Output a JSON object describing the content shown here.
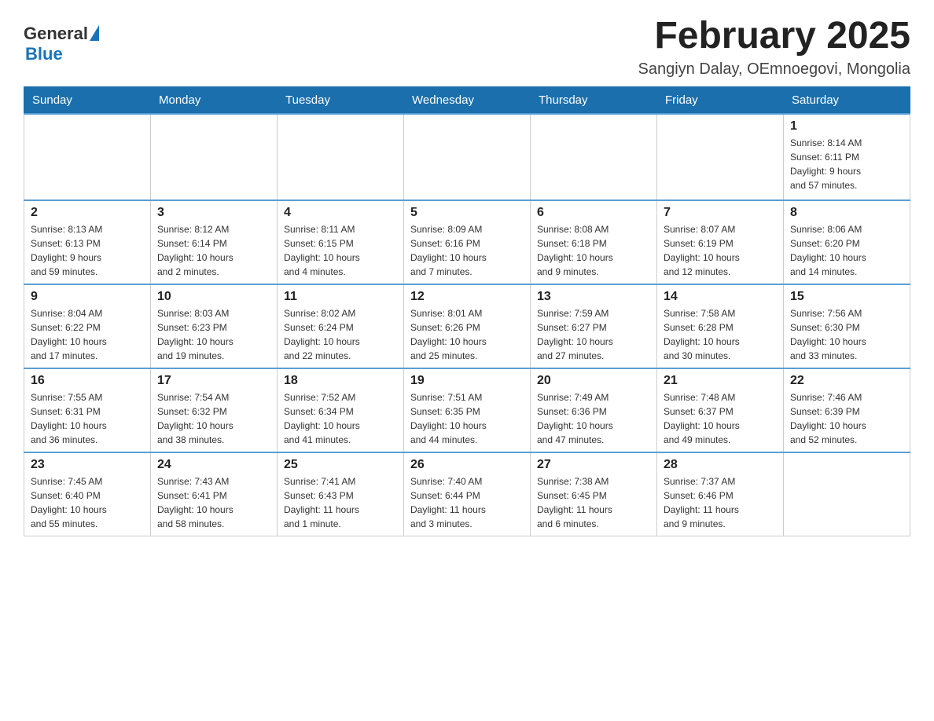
{
  "header": {
    "logo": {
      "general": "General",
      "blue": "Blue"
    },
    "title": "February 2025",
    "subtitle": "Sangiyn Dalay, OEmnoegovi, Mongolia"
  },
  "weekdays": [
    "Sunday",
    "Monday",
    "Tuesday",
    "Wednesday",
    "Thursday",
    "Friday",
    "Saturday"
  ],
  "weeks": [
    [
      {
        "day": "",
        "info": ""
      },
      {
        "day": "",
        "info": ""
      },
      {
        "day": "",
        "info": ""
      },
      {
        "day": "",
        "info": ""
      },
      {
        "day": "",
        "info": ""
      },
      {
        "day": "",
        "info": ""
      },
      {
        "day": "1",
        "info": "Sunrise: 8:14 AM\nSunset: 6:11 PM\nDaylight: 9 hours\nand 57 minutes."
      }
    ],
    [
      {
        "day": "2",
        "info": "Sunrise: 8:13 AM\nSunset: 6:13 PM\nDaylight: 9 hours\nand 59 minutes."
      },
      {
        "day": "3",
        "info": "Sunrise: 8:12 AM\nSunset: 6:14 PM\nDaylight: 10 hours\nand 2 minutes."
      },
      {
        "day": "4",
        "info": "Sunrise: 8:11 AM\nSunset: 6:15 PM\nDaylight: 10 hours\nand 4 minutes."
      },
      {
        "day": "5",
        "info": "Sunrise: 8:09 AM\nSunset: 6:16 PM\nDaylight: 10 hours\nand 7 minutes."
      },
      {
        "day": "6",
        "info": "Sunrise: 8:08 AM\nSunset: 6:18 PM\nDaylight: 10 hours\nand 9 minutes."
      },
      {
        "day": "7",
        "info": "Sunrise: 8:07 AM\nSunset: 6:19 PM\nDaylight: 10 hours\nand 12 minutes."
      },
      {
        "day": "8",
        "info": "Sunrise: 8:06 AM\nSunset: 6:20 PM\nDaylight: 10 hours\nand 14 minutes."
      }
    ],
    [
      {
        "day": "9",
        "info": "Sunrise: 8:04 AM\nSunset: 6:22 PM\nDaylight: 10 hours\nand 17 minutes."
      },
      {
        "day": "10",
        "info": "Sunrise: 8:03 AM\nSunset: 6:23 PM\nDaylight: 10 hours\nand 19 minutes."
      },
      {
        "day": "11",
        "info": "Sunrise: 8:02 AM\nSunset: 6:24 PM\nDaylight: 10 hours\nand 22 minutes."
      },
      {
        "day": "12",
        "info": "Sunrise: 8:01 AM\nSunset: 6:26 PM\nDaylight: 10 hours\nand 25 minutes."
      },
      {
        "day": "13",
        "info": "Sunrise: 7:59 AM\nSunset: 6:27 PM\nDaylight: 10 hours\nand 27 minutes."
      },
      {
        "day": "14",
        "info": "Sunrise: 7:58 AM\nSunset: 6:28 PM\nDaylight: 10 hours\nand 30 minutes."
      },
      {
        "day": "15",
        "info": "Sunrise: 7:56 AM\nSunset: 6:30 PM\nDaylight: 10 hours\nand 33 minutes."
      }
    ],
    [
      {
        "day": "16",
        "info": "Sunrise: 7:55 AM\nSunset: 6:31 PM\nDaylight: 10 hours\nand 36 minutes."
      },
      {
        "day": "17",
        "info": "Sunrise: 7:54 AM\nSunset: 6:32 PM\nDaylight: 10 hours\nand 38 minutes."
      },
      {
        "day": "18",
        "info": "Sunrise: 7:52 AM\nSunset: 6:34 PM\nDaylight: 10 hours\nand 41 minutes."
      },
      {
        "day": "19",
        "info": "Sunrise: 7:51 AM\nSunset: 6:35 PM\nDaylight: 10 hours\nand 44 minutes."
      },
      {
        "day": "20",
        "info": "Sunrise: 7:49 AM\nSunset: 6:36 PM\nDaylight: 10 hours\nand 47 minutes."
      },
      {
        "day": "21",
        "info": "Sunrise: 7:48 AM\nSunset: 6:37 PM\nDaylight: 10 hours\nand 49 minutes."
      },
      {
        "day": "22",
        "info": "Sunrise: 7:46 AM\nSunset: 6:39 PM\nDaylight: 10 hours\nand 52 minutes."
      }
    ],
    [
      {
        "day": "23",
        "info": "Sunrise: 7:45 AM\nSunset: 6:40 PM\nDaylight: 10 hours\nand 55 minutes."
      },
      {
        "day": "24",
        "info": "Sunrise: 7:43 AM\nSunset: 6:41 PM\nDaylight: 10 hours\nand 58 minutes."
      },
      {
        "day": "25",
        "info": "Sunrise: 7:41 AM\nSunset: 6:43 PM\nDaylight: 11 hours\nand 1 minute."
      },
      {
        "day": "26",
        "info": "Sunrise: 7:40 AM\nSunset: 6:44 PM\nDaylight: 11 hours\nand 3 minutes."
      },
      {
        "day": "27",
        "info": "Sunrise: 7:38 AM\nSunset: 6:45 PM\nDaylight: 11 hours\nand 6 minutes."
      },
      {
        "day": "28",
        "info": "Sunrise: 7:37 AM\nSunset: 6:46 PM\nDaylight: 11 hours\nand 9 minutes."
      },
      {
        "day": "",
        "info": ""
      }
    ]
  ]
}
